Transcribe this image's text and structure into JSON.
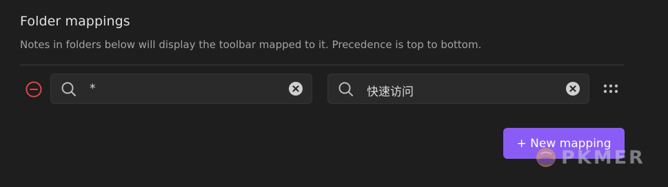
{
  "section": {
    "title": "Folder mappings",
    "description": "Notes in folders below will display the toolbar mapped to it. Precedence is top to bottom."
  },
  "mappings": [
    {
      "folder_value": "*",
      "toolbar_value": "快速访问"
    }
  ],
  "new_mapping_button": {
    "label": "+ New mapping"
  },
  "watermark": {
    "text": "PKMER"
  },
  "colors": {
    "accent": "#8a5cf5",
    "remove": "#e0454a",
    "background": "#1e1e1e"
  },
  "icons": {
    "remove": "minus-circle-icon",
    "search": "search-icon",
    "clear": "x-circle-icon",
    "drag": "grip-dots-icon"
  }
}
